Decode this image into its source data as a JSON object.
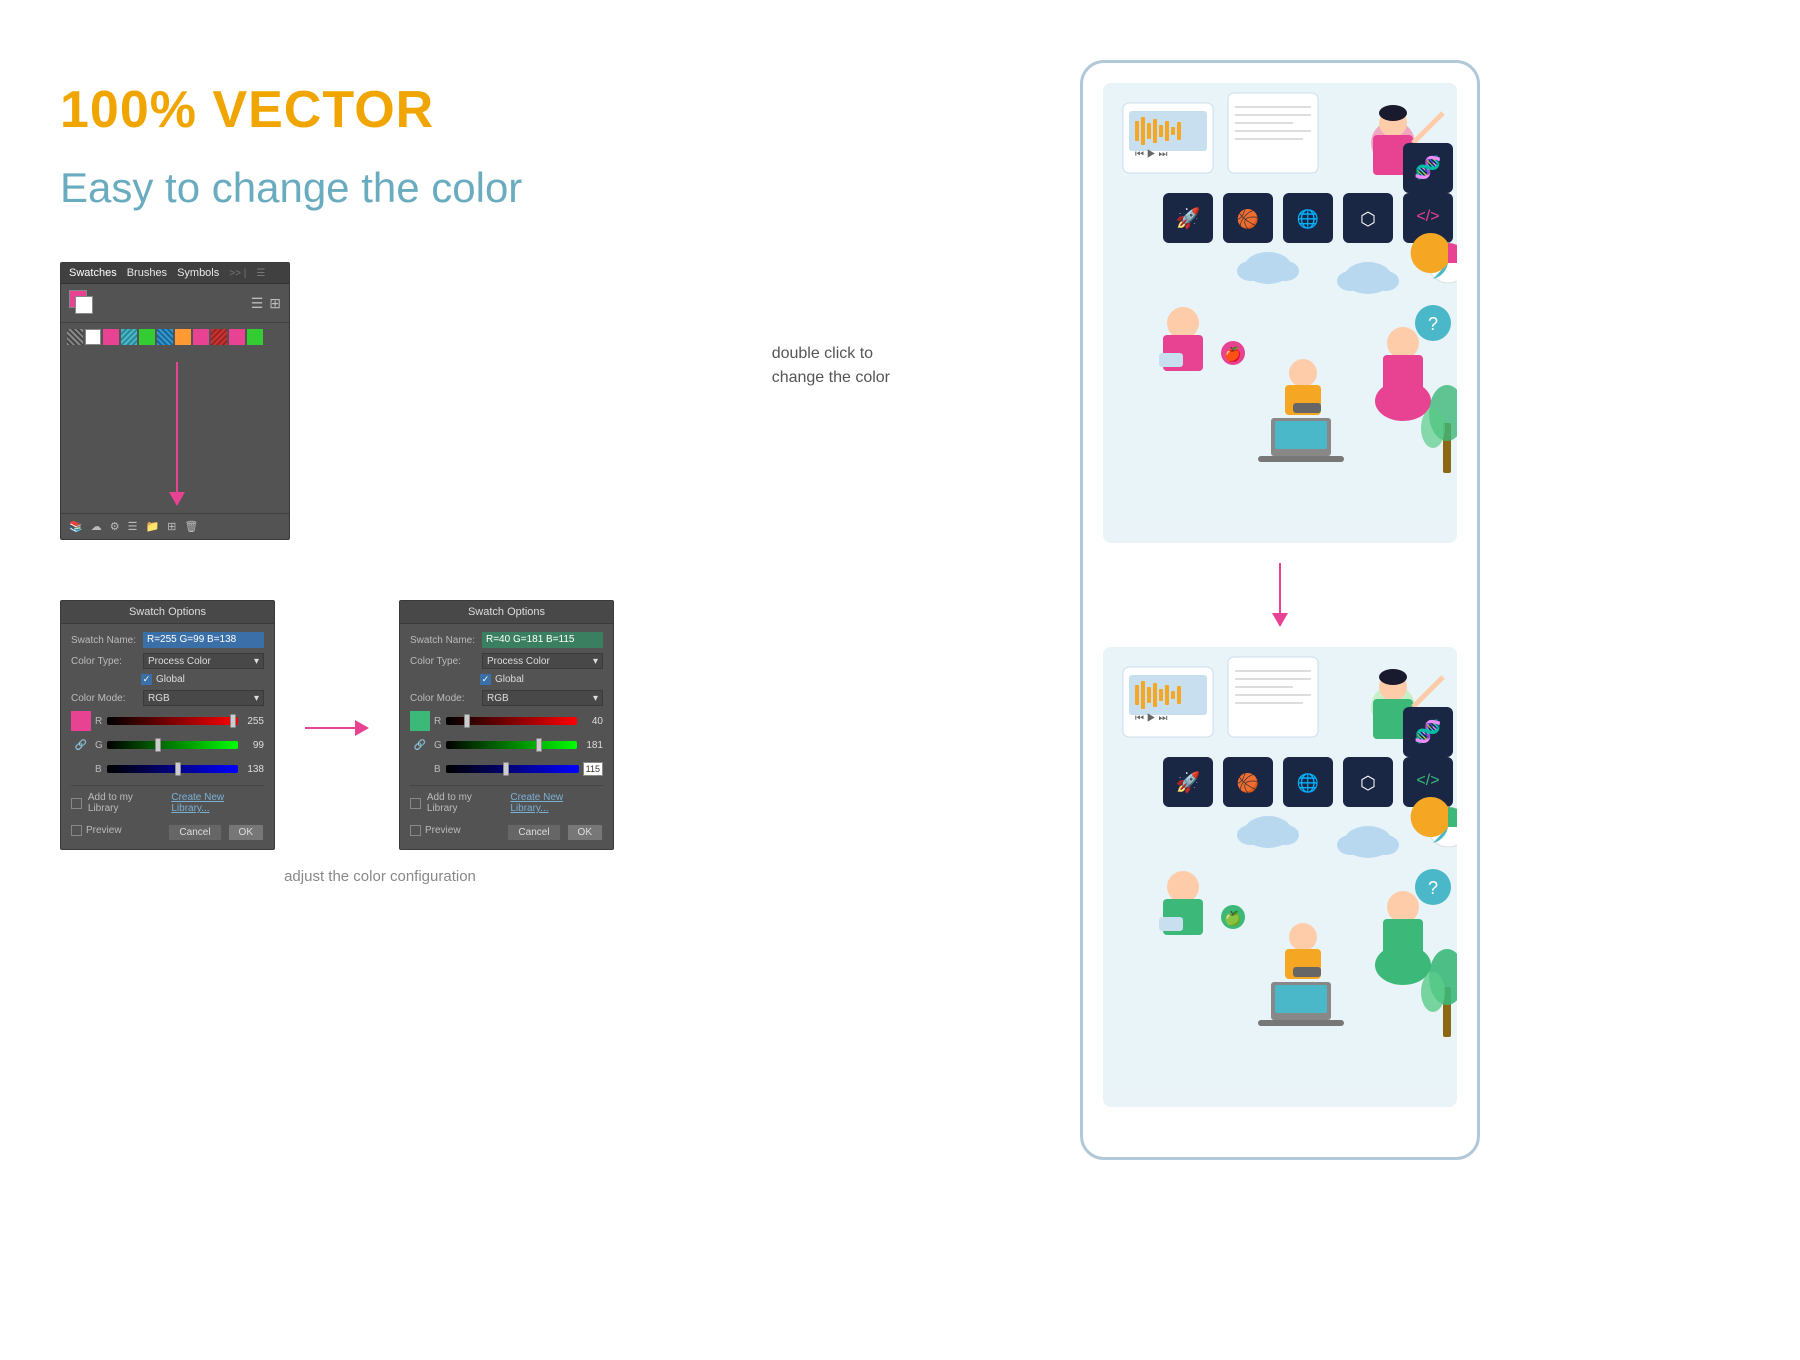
{
  "left": {
    "vector_title": "100% VECTOR",
    "subtitle": "Easy to change the color",
    "dbl_click_label": "double click to\nchange the color",
    "swatches_panel": {
      "tabs": [
        "Swatches",
        "Brushes",
        "Symbols"
      ],
      "active_tab": "Swatches"
    },
    "swatch_options_1": {
      "title": "Swatch Options",
      "swatch_name_label": "Swatch Name:",
      "swatch_name_value": "R=255 G=99 B=138",
      "color_type_label": "Color Type:",
      "color_type_value": "Process Color",
      "global_label": "Global",
      "color_mode_label": "Color Mode:",
      "color_mode_value": "RGB",
      "r_label": "R",
      "r_value": "255",
      "g_label": "G",
      "g_value": "99",
      "b_label": "B",
      "b_value": "138",
      "add_library_label": "Add to my Library",
      "create_library_label": "Create New Library...",
      "preview_label": "Preview",
      "cancel_label": "Cancel",
      "ok_label": "OK"
    },
    "swatch_options_2": {
      "title": "Swatch Options",
      "swatch_name_label": "Swatch Name:",
      "swatch_name_value": "R=40 G=181 B=115",
      "color_type_label": "Color Type:",
      "color_type_value": "Process Color",
      "global_label": "Global",
      "color_mode_label": "Color Mode:",
      "color_mode_value": "RGB",
      "r_label": "R",
      "r_value": "40",
      "g_label": "G",
      "g_value": "181",
      "b_label": "B",
      "b_value": "115",
      "add_library_label": "Add to my Library",
      "create_library_label": "Create New Library...",
      "preview_label": "Preview",
      "cancel_label": "Cancel",
      "ok_label": "OK"
    },
    "bottom_caption": "adjust the color configuration"
  },
  "swatches_colors": [
    "#cc3333",
    "#cc6600",
    "#cccc00",
    "#33cc33",
    "#3399cc",
    "#cc33cc",
    "#ff6666",
    "#ff9933",
    "#ffff66",
    "#66ff66",
    "#66ccff",
    "#cc99ff",
    "#880000",
    "#884400",
    "#888800",
    "#008800",
    "#005588",
    "#880088"
  ],
  "right": {
    "has_before": true,
    "has_after": true,
    "before_colors": "pink/red theme",
    "after_colors": "green theme"
  }
}
